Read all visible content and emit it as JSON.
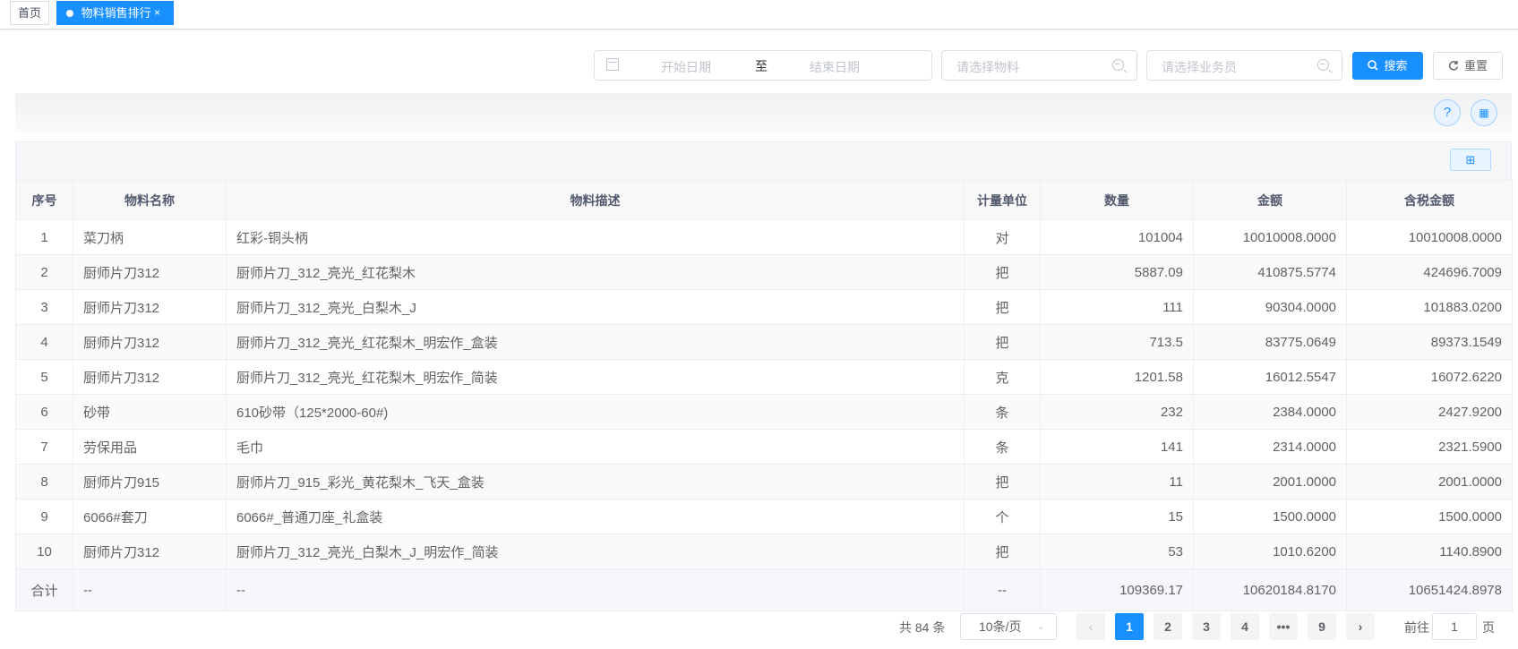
{
  "tags": {
    "home_label": "首页",
    "active_label": "物料销售排行",
    "close_glyph": "×"
  },
  "search": {
    "start_date_placeholder": "开始日期",
    "range_separator": "至",
    "end_date_placeholder": "结束日期",
    "material_placeholder": "请选择物料",
    "salesman_placeholder": "请选择业务员",
    "search_label": "搜索",
    "reset_label": "重置"
  },
  "toolbar": {
    "help_glyph": "?",
    "qr_glyph": "▦",
    "grid_glyph": "⊞"
  },
  "table": {
    "columns": [
      "序号",
      "物料名称",
      "物料描述",
      "计量单位",
      "数量",
      "金额",
      "含税金额"
    ],
    "rows": [
      [
        "1",
        "菜刀柄",
        "红彩-铜头柄",
        "对",
        "101004",
        "10010008.0000",
        "10010008.0000"
      ],
      [
        "2",
        "厨师片刀312",
        "厨师片刀_312_亮光_红花梨木",
        "把",
        "5887.09",
        "410875.5774",
        "424696.7009"
      ],
      [
        "3",
        "厨师片刀312",
        "厨师片刀_312_亮光_白梨木_J",
        "把",
        "111",
        "90304.0000",
        "101883.0200"
      ],
      [
        "4",
        "厨师片刀312",
        "厨师片刀_312_亮光_红花梨木_明宏作_盒装",
        "把",
        "713.5",
        "83775.0649",
        "89373.1549"
      ],
      [
        "5",
        "厨师片刀312",
        "厨师片刀_312_亮光_红花梨木_明宏作_简装",
        "克",
        "1201.58",
        "16012.5547",
        "16072.6220"
      ],
      [
        "6",
        "砂带",
        "610砂带（125*2000-60#)",
        "条",
        "232",
        "2384.0000",
        "2427.9200"
      ],
      [
        "7",
        "劳保用品",
        "毛巾",
        "条",
        "141",
        "2314.0000",
        "2321.5900"
      ],
      [
        "8",
        "厨师片刀915",
        "厨师片刀_915_彩光_黄花梨木_飞天_盒装",
        "把",
        "11",
        "2001.0000",
        "2001.0000"
      ],
      [
        "9",
        "6066#套刀",
        "6066#_普通刀座_礼盒装",
        "个",
        "15",
        "1500.0000",
        "1500.0000"
      ],
      [
        "10",
        "厨师片刀312",
        "厨师片刀_312_亮光_白梨木_J_明宏作_简装",
        "把",
        "53",
        "1010.6200",
        "1140.8900"
      ]
    ],
    "footer": [
      "合计",
      "--",
      "--",
      "--",
      "109369.17",
      "10620184.8170",
      "10651424.8978"
    ]
  },
  "pagination": {
    "total_text": "共 84 条",
    "page_size": "10条/页",
    "prev_glyph": "‹",
    "next_glyph": "›",
    "pages": [
      "1",
      "2",
      "3",
      "4",
      "•••",
      "9"
    ],
    "current_page": "1",
    "goto_label": "前往",
    "goto_value": "1",
    "page_suffix": "页"
  }
}
